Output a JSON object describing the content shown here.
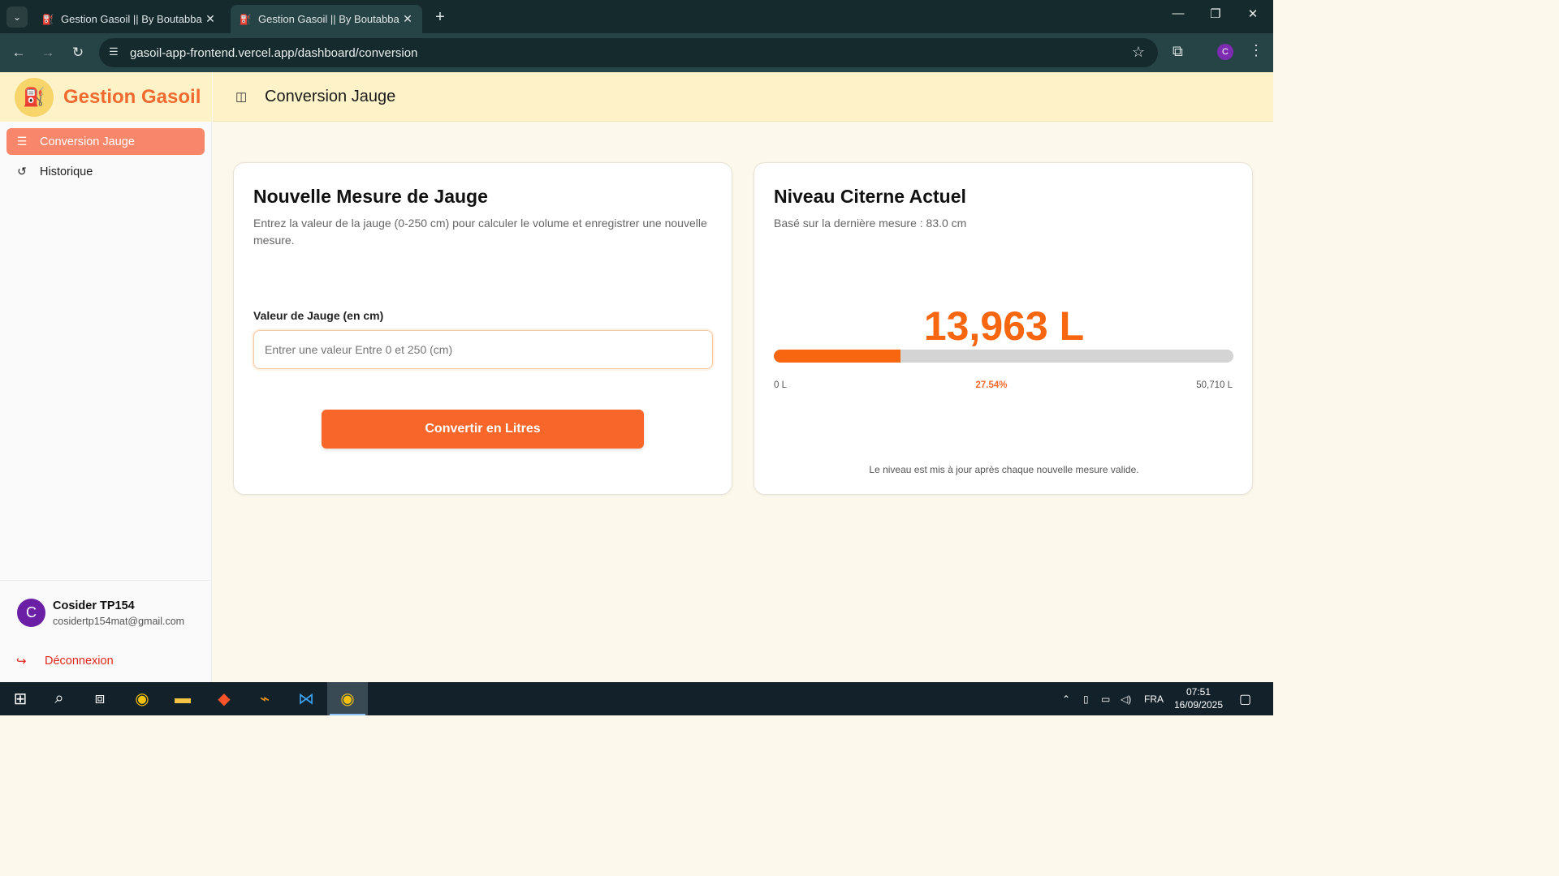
{
  "browser": {
    "tabs": [
      {
        "title": "Gestion Gasoil || By Boutabba L",
        "active": false
      },
      {
        "title": "Gestion Gasoil || By Boutabba L",
        "active": true
      }
    ],
    "url": "gasoil-app-frontend.vercel.app/dashboard/conversion",
    "profile_initial": "C"
  },
  "sidebar": {
    "brand": "Gestion Gasoil",
    "items": [
      {
        "label": "Conversion Jauge",
        "icon": "sliders-icon",
        "active": true
      },
      {
        "label": "Historique",
        "icon": "history-icon",
        "active": false
      }
    ],
    "user": {
      "initial": "C",
      "name": "Cosider TP154",
      "email": "cosidertp154mat@gmail.com"
    },
    "logout_label": "Déconnexion"
  },
  "header": {
    "title": "Conversion Jauge"
  },
  "form_card": {
    "title": "Nouvelle Mesure de Jauge",
    "description": "Entrez la valeur de la jauge (0-250 cm) pour calculer le volume et enregistrer une nouvelle mesure.",
    "field_label": "Valeur de Jauge (en cm)",
    "field_placeholder": "Entrer une valeur Entre 0 et 250 (cm)",
    "field_value": "",
    "button_label": "Convertir en Litres"
  },
  "level_card": {
    "title": "Niveau Citerne Actuel",
    "subtitle": "Basé sur la dernière mesure : 83.0 cm",
    "volume": "13,963 L",
    "fill_fraction": 0.2754,
    "min_label": "0 L",
    "percent_label": "27.54%",
    "max_label": "50,710 L",
    "note": "Le niveau est mis à jour après chaque nouvelle mesure valide."
  },
  "taskbar": {
    "language": "FRA",
    "time": "07:51",
    "date": "16/09/2025"
  },
  "colors": {
    "accent": "#f8662a",
    "brand": "#f26a2e",
    "header_bg": "#fdf2c8",
    "danger": "#e0271b"
  }
}
